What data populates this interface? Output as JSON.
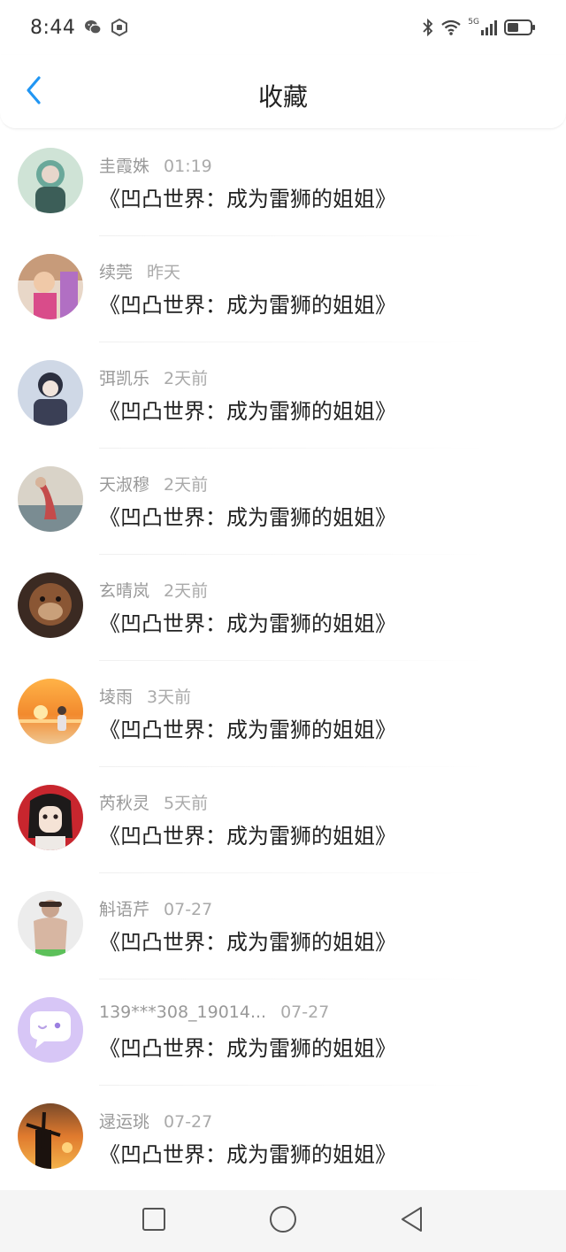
{
  "status_bar": {
    "time": "8:44",
    "network": "5G",
    "icons": [
      "wechat-icon",
      "app-icon",
      "bluetooth-icon",
      "wifi-icon",
      "signal-icon",
      "battery-icon"
    ]
  },
  "header": {
    "title": "收藏",
    "back_icon": "chevron-left-icon",
    "accent_color": "#2196f3"
  },
  "items": [
    {
      "name": "圭霞姝",
      "time": "01:19",
      "title": "《凹凸世界：成为雷狮的姐姐》",
      "avatar_color": "#6aa89a"
    },
    {
      "name": "续莞",
      "time": "昨天",
      "title": "《凹凸世界：成为雷狮的姐姐》",
      "avatar_color": "#c7a06a"
    },
    {
      "name": "弭凯乐",
      "time": "2天前",
      "title": "《凹凸世界：成为雷狮的姐姐》",
      "avatar_color": "#40465c"
    },
    {
      "name": "天淑穆",
      "time": "2天前",
      "title": "《凹凸世界：成为雷狮的姐姐》",
      "avatar_color": "#b58a6e"
    },
    {
      "name": "玄晴岚",
      "time": "2天前",
      "title": "《凹凸世界：成为雷狮的姐姐》",
      "avatar_color": "#6b4a33"
    },
    {
      "name": "堎雨",
      "time": "3天前",
      "title": "《凹凸世界：成为雷狮的姐姐》",
      "avatar_color": "#f0a23a"
    },
    {
      "name": "芮秋灵",
      "time": "5天前",
      "title": "《凹凸世界：成为雷狮的姐姐》",
      "avatar_color": "#c8262e"
    },
    {
      "name": "斛语芹",
      "time": "07-27",
      "title": "《凹凸世界：成为雷狮的姐姐》",
      "avatar_color": "#d8c0ad"
    },
    {
      "name": "139***308_19014...",
      "time": "07-27",
      "title": "《凹凸世界：成为雷狮的姐姐》",
      "avatar_color": "#c9b2f0"
    },
    {
      "name": "逯运珧",
      "time": "07-27",
      "title": "《凹凸世界：成为雷狮的姐姐》",
      "avatar_color": "#d36b2a"
    }
  ],
  "nav_bar": {
    "icons": [
      "recent-apps-icon",
      "home-icon",
      "back-triangle-icon"
    ]
  }
}
